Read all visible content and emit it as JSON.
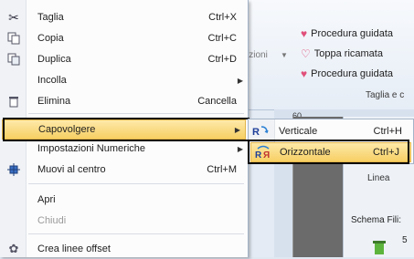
{
  "ribbon": {
    "faded_item": "izioni",
    "buttons": [
      {
        "label": "Procedura guidata"
      },
      {
        "label": "Toppa ricamata"
      },
      {
        "label": "Procedura guidata"
      }
    ],
    "group_label": "Taglia e c"
  },
  "workspace": {
    "ruler_value": "60",
    "lines_label": "Linea",
    "schema_label": "Schema Fili:",
    "schema_number": "5"
  },
  "menu": {
    "items": [
      {
        "label": "Taglia",
        "shortcut": "Ctrl+X",
        "icon": "scissors-icon"
      },
      {
        "label": "Copia",
        "shortcut": "Ctrl+C",
        "icon": "copy-icon"
      },
      {
        "label": "Duplica",
        "shortcut": "Ctrl+D",
        "icon": "duplicate-icon"
      },
      {
        "label": "Incolla",
        "shortcut": "",
        "icon": ""
      },
      {
        "label": "Elimina",
        "shortcut": "Cancella",
        "icon": "trash-icon"
      },
      {
        "label": "Capovolgere",
        "shortcut": "",
        "icon": ""
      },
      {
        "label": "Impostazioni Numeriche",
        "shortcut": "",
        "icon": ""
      },
      {
        "label": "Muovi al centro",
        "shortcut": "Ctrl+M",
        "icon": "center-icon"
      },
      {
        "label": "Apri",
        "shortcut": "",
        "icon": ""
      },
      {
        "label": "Chiudi",
        "shortcut": "",
        "icon": ""
      },
      {
        "label": "Crea linee offset",
        "shortcut": "",
        "icon": "offset-icon"
      }
    ]
  },
  "submenu": {
    "items": [
      {
        "label": "Verticale",
        "shortcut": "Ctrl+H",
        "icon": "flip-vertical-icon"
      },
      {
        "label": "Orizzontale",
        "shortcut": "Ctrl+J",
        "icon": "flip-horizontal-icon"
      }
    ]
  }
}
